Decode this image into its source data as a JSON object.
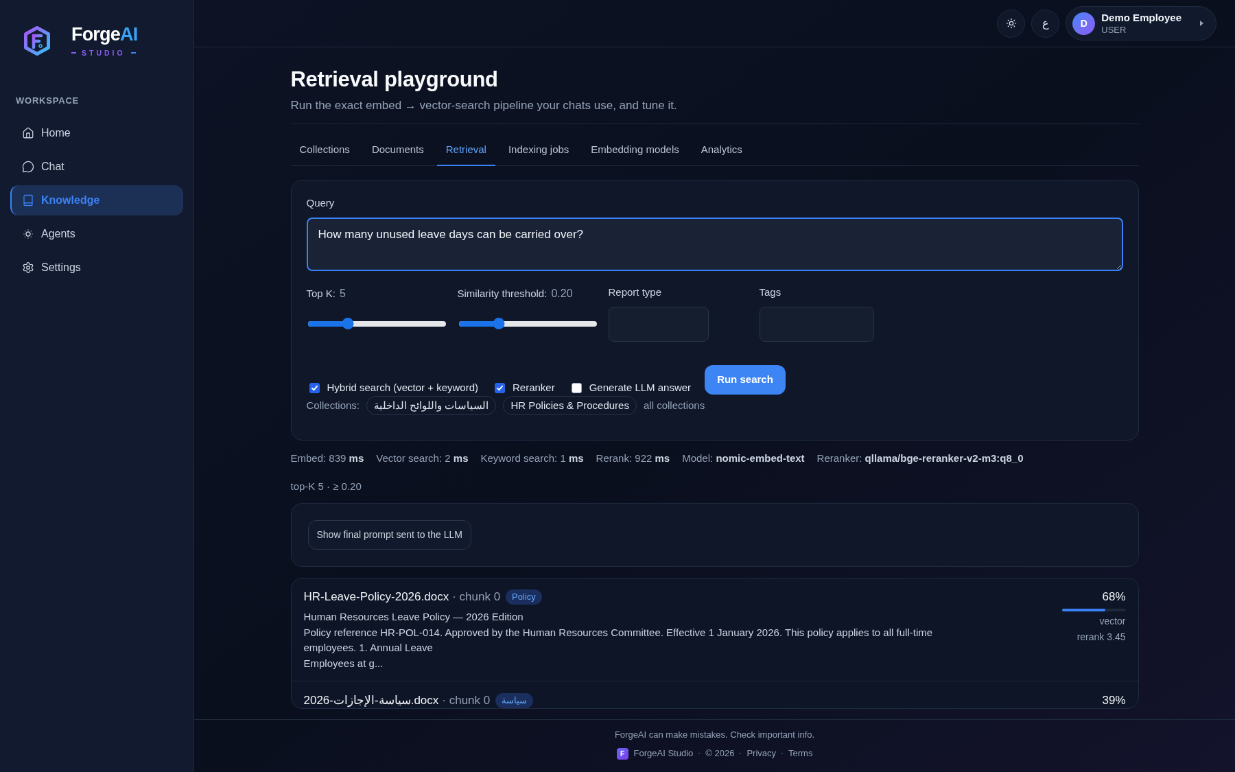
{
  "sidebar": {
    "brand": {
      "name": "Forge",
      "accent": "AI",
      "tagline": "STUDIO"
    },
    "section_title": "WORKSPACE",
    "items": [
      {
        "label": "Home",
        "selected": false
      },
      {
        "label": "Chat",
        "selected": false
      },
      {
        "label": "Knowledge",
        "selected": true
      },
      {
        "label": "Agents",
        "selected": false
      },
      {
        "label": "Settings",
        "selected": false
      }
    ]
  },
  "header": {
    "language_button": "ع",
    "user": {
      "initial": "D",
      "name": "Demo Employee",
      "role": "USER"
    }
  },
  "page": {
    "title": "Retrieval playground",
    "subtitle": "Run the exact embed → vector-search pipeline your chats use, and tune it."
  },
  "tabs": [
    {
      "label": "Collections",
      "selected": false
    },
    {
      "label": "Documents",
      "selected": false
    },
    {
      "label": "Retrieval",
      "selected": true
    },
    {
      "label": "Indexing jobs",
      "selected": false
    },
    {
      "label": "Embedding models",
      "selected": false
    },
    {
      "label": "Analytics",
      "selected": false
    }
  ],
  "query_form": {
    "query": {
      "label": "Query",
      "value": "How many unused leave days can be carried over?",
      "focused": true
    },
    "top_k": {
      "label": "Top K:",
      "value": "5",
      "level": 0.29
    },
    "similarity": {
      "label": "Similarity threshold:",
      "value": "0.20",
      "level": 0.29
    },
    "report_type": {
      "label": "Report type"
    },
    "tags": {
      "label": "Tags"
    },
    "options": [
      {
        "label": "Hybrid search (vector + keyword)",
        "checked": true
      },
      {
        "label": "Reranker",
        "checked": true
      },
      {
        "label": "Generate LLM answer",
        "checked": false
      }
    ],
    "run_button": "Run search",
    "collections": {
      "label": "Collections:",
      "chips": [
        "السياسات واللوائح الداخلية",
        "HR Policies & Procedures"
      ],
      "all_link": "all collections"
    }
  },
  "stats": [
    "Embed: 839 **ms**",
    "Vector search: 2 **ms**",
    "Keyword search: 1 **ms**",
    "Rerank: 922 **ms**",
    "Model: **nomic-embed-text**",
    "Reranker: **qllama/bge-reranker-v2-m3:q8_0**"
  ],
  "filter_summary": "top-K 5 · ≥ 0.20",
  "prompt_button": "Show final prompt sent to the LLM",
  "results": [
    {
      "file": "HR-Leave-Policy-2026.docx",
      "chunk": "· chunk 0",
      "tag": "Policy",
      "score": "68%",
      "level": 0.68,
      "score_label": "vector",
      "rerank": "rerank 3.45",
      "snippet": "Human Resources Leave Policy — 2026 Edition\nPolicy reference HR-POL-014. Approved by the Human Resources Committee. Effective 1 January 2026. This policy applies to all full-time employees. 1. Annual Leave\nEmployees at g..."
    },
    {
      "file": "سياسة-الإجازات-2026.docx",
      "chunk": "· chunk 0",
      "tag": "سياسة",
      "score": "39%"
    }
  ],
  "footer": {
    "disclaimer": "ForgeAI can make mistakes. Check important info.",
    "logo_letter": "F",
    "brand": "ForgeAI Studio",
    "copyright": "© 2026",
    "links": [
      "Privacy",
      "Terms"
    ]
  }
}
